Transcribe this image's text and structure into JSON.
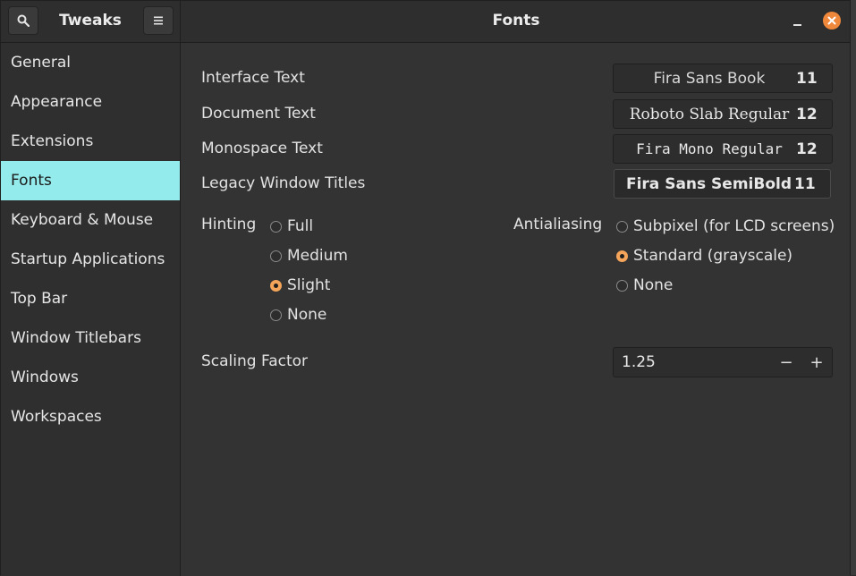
{
  "header": {
    "app_title": "Tweaks",
    "page_title": "Fonts"
  },
  "sidebar": {
    "items": [
      {
        "label": "General"
      },
      {
        "label": "Appearance"
      },
      {
        "label": "Extensions"
      },
      {
        "label": "Fonts"
      },
      {
        "label": "Keyboard & Mouse"
      },
      {
        "label": "Startup Applications"
      },
      {
        "label": "Top Bar"
      },
      {
        "label": "Window Titlebars"
      },
      {
        "label": "Windows"
      },
      {
        "label": "Workspaces"
      }
    ],
    "selected": "Fonts"
  },
  "fonts": {
    "rows": [
      {
        "label": "Interface Text",
        "font": "Fira Sans Book",
        "size": "11"
      },
      {
        "label": "Document Text",
        "font": "Roboto Slab Regular",
        "size": "12"
      },
      {
        "label": "Monospace Text",
        "font": "Fira Mono Regular",
        "size": "12"
      },
      {
        "label": "Legacy Window Titles",
        "font": "Fira Sans SemiBold",
        "size": "11"
      }
    ]
  },
  "hinting": {
    "label": "Hinting",
    "options": [
      "Full",
      "Medium",
      "Slight",
      "None"
    ],
    "selected": "Slight"
  },
  "antialiasing": {
    "label": "Antialiasing",
    "options": [
      "Subpixel (for LCD screens)",
      "Standard (grayscale)",
      "None"
    ],
    "selected": "Standard (grayscale)"
  },
  "scaling": {
    "label": "Scaling Factor",
    "value": "1.25",
    "decrement_symbol": "−",
    "increment_symbol": "+"
  },
  "icons": {
    "search": "search-icon",
    "menu": "hamburger-menu-icon",
    "minimize": "minimize-icon",
    "close": "close-icon"
  },
  "colors": {
    "accent_selection": "#94ebeb",
    "radio_active": "#f5a55a",
    "close_button": "#f0883c"
  }
}
